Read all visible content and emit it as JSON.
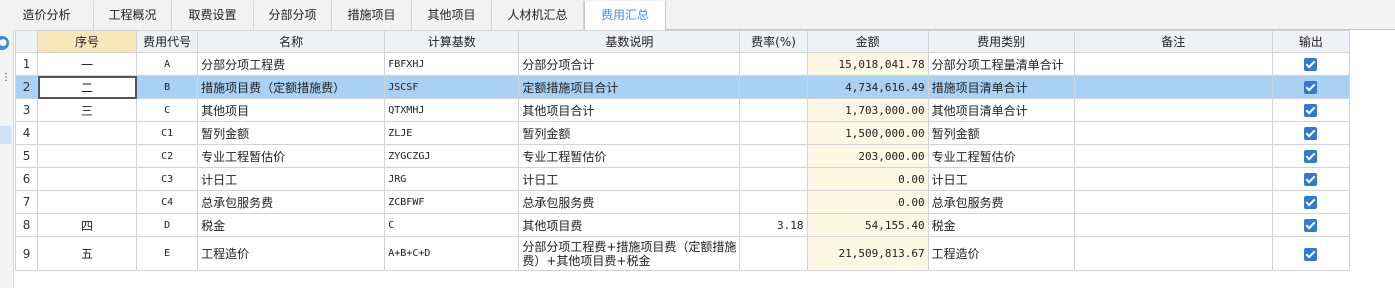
{
  "tabs": [
    {
      "label": "造价分析",
      "active": false
    },
    {
      "label": "工程概况",
      "active": false
    },
    {
      "label": "取费设置",
      "active": false
    },
    {
      "label": "分部分项",
      "active": false
    },
    {
      "label": "措施项目",
      "active": false
    },
    {
      "label": "其他项目",
      "active": false
    },
    {
      "label": "人材机汇总",
      "active": false
    },
    {
      "label": "费用汇总",
      "active": true
    }
  ],
  "left_strip": {
    "circle_icon": "info-circle-icon",
    "dots": "⋮"
  },
  "columns": [
    "序号",
    "费用代号",
    "名称",
    "计算基数",
    "基数说明",
    "费率(%)",
    "金额",
    "费用类别",
    "备注",
    "输出"
  ],
  "rows": [
    {
      "num": "1",
      "seq": "一",
      "code": "A",
      "name": "分部分项工程费",
      "base": "FBFXHJ",
      "desc": "分部分项合计",
      "rate": "",
      "amount": "15,018,041.78",
      "category": "分部分项工程量清单合计",
      "note": "",
      "output": true
    },
    {
      "num": "2",
      "seq": "二",
      "code": "B",
      "name": "措施项目费（定额措施费）",
      "base": "JSCSF",
      "desc": "定额措施项目合计",
      "rate": "",
      "amount": "4,734,616.49",
      "category": "措施项目清单合计",
      "note": "",
      "output": true
    },
    {
      "num": "3",
      "seq": "三",
      "code": "C",
      "name": "其他项目",
      "base": "QTXMHJ",
      "desc": "其他项目合计",
      "rate": "",
      "amount": "1,703,000.00",
      "category": "其他项目清单合计",
      "note": "",
      "output": true
    },
    {
      "num": "4",
      "seq": "",
      "code": "C1",
      "name": "暂列金额",
      "base": "ZLJE",
      "desc": "暂列金额",
      "rate": "",
      "amount": "1,500,000.00",
      "category": "暂列金额",
      "note": "",
      "output": true
    },
    {
      "num": "5",
      "seq": "",
      "code": "C2",
      "name": "专业工程暂估价",
      "base": "ZYGCZGJ",
      "desc": "专业工程暂估价",
      "rate": "",
      "amount": "203,000.00",
      "category": "专业工程暂估价",
      "note": "",
      "output": true
    },
    {
      "num": "6",
      "seq": "",
      "code": "C3",
      "name": "计日工",
      "base": "JRG",
      "desc": "计日工",
      "rate": "",
      "amount": "0.00",
      "category": "计日工",
      "note": "",
      "output": true
    },
    {
      "num": "7",
      "seq": "",
      "code": "C4",
      "name": "总承包服务费",
      "base": "ZCBFWF",
      "desc": "总承包服务费",
      "rate": "",
      "amount": "0.00",
      "category": "总承包服务费",
      "note": "",
      "output": true
    },
    {
      "num": "8",
      "seq": "四",
      "code": "D",
      "name": "税金",
      "base": "C",
      "desc": "其他项目费",
      "rate": "3.18",
      "amount": "54,155.40",
      "category": "税金",
      "note": "",
      "output": true
    },
    {
      "num": "9",
      "seq": "五",
      "code": "E",
      "name": "工程造价",
      "base": "A+B+C+D",
      "desc": "分部分项工程费+措施项目费（定额措施费）+其他项目费+税金",
      "rate": "",
      "amount": "21,509,813.67",
      "category": "工程造价",
      "note": "",
      "output": true
    }
  ],
  "selected_row": 1,
  "colors": {
    "accent": "#4a90d9",
    "selected_row": "#a9d1f3",
    "amount_bg": "#fdf8e4",
    "checkbox": "#2f7ad3"
  }
}
